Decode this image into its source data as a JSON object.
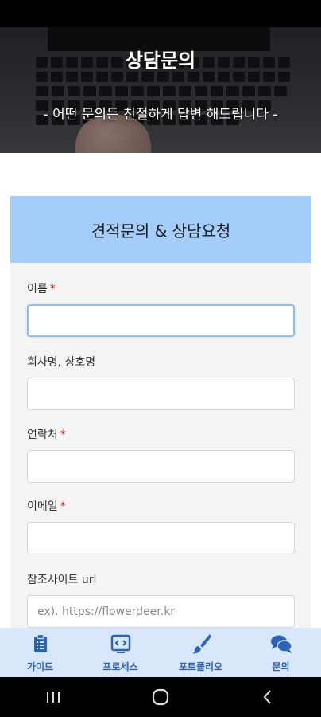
{
  "hero": {
    "title": "상담문의",
    "subtitle": "- 어떤 문의든 친절하게 답변 해드립니다 -"
  },
  "form": {
    "heading": "견적문의 & 상담요청",
    "required_mark": "*",
    "fields": [
      {
        "label": "이름",
        "required": true,
        "value": "",
        "placeholder": ""
      },
      {
        "label": "회사명, 상호명",
        "required": false,
        "value": "",
        "placeholder": ""
      },
      {
        "label": "연락처",
        "required": true,
        "value": "",
        "placeholder": ""
      },
      {
        "label": "이메일",
        "required": true,
        "value": "",
        "placeholder": ""
      },
      {
        "label": "참조사이트 url",
        "required": false,
        "value": "",
        "placeholder": "ex). https://flowerdeer.kr"
      }
    ]
  },
  "bottom_nav": {
    "accent_color": "#2a63b8",
    "background_color": "#d8e7f9",
    "items": [
      {
        "label": "가이드",
        "icon": "clipboard-icon"
      },
      {
        "label": "프로세스",
        "icon": "code-window-icon"
      },
      {
        "label": "포트폴리오",
        "icon": "paintbrush-icon"
      },
      {
        "label": "문의",
        "icon": "chat-bubbles-icon"
      }
    ]
  },
  "system_nav": {
    "icons": [
      "recent-apps-icon",
      "home-icon",
      "back-icon"
    ]
  },
  "colors": {
    "header_band": "#a4cdfb",
    "form_background": "#f5f5f5",
    "required": "#e02020"
  }
}
